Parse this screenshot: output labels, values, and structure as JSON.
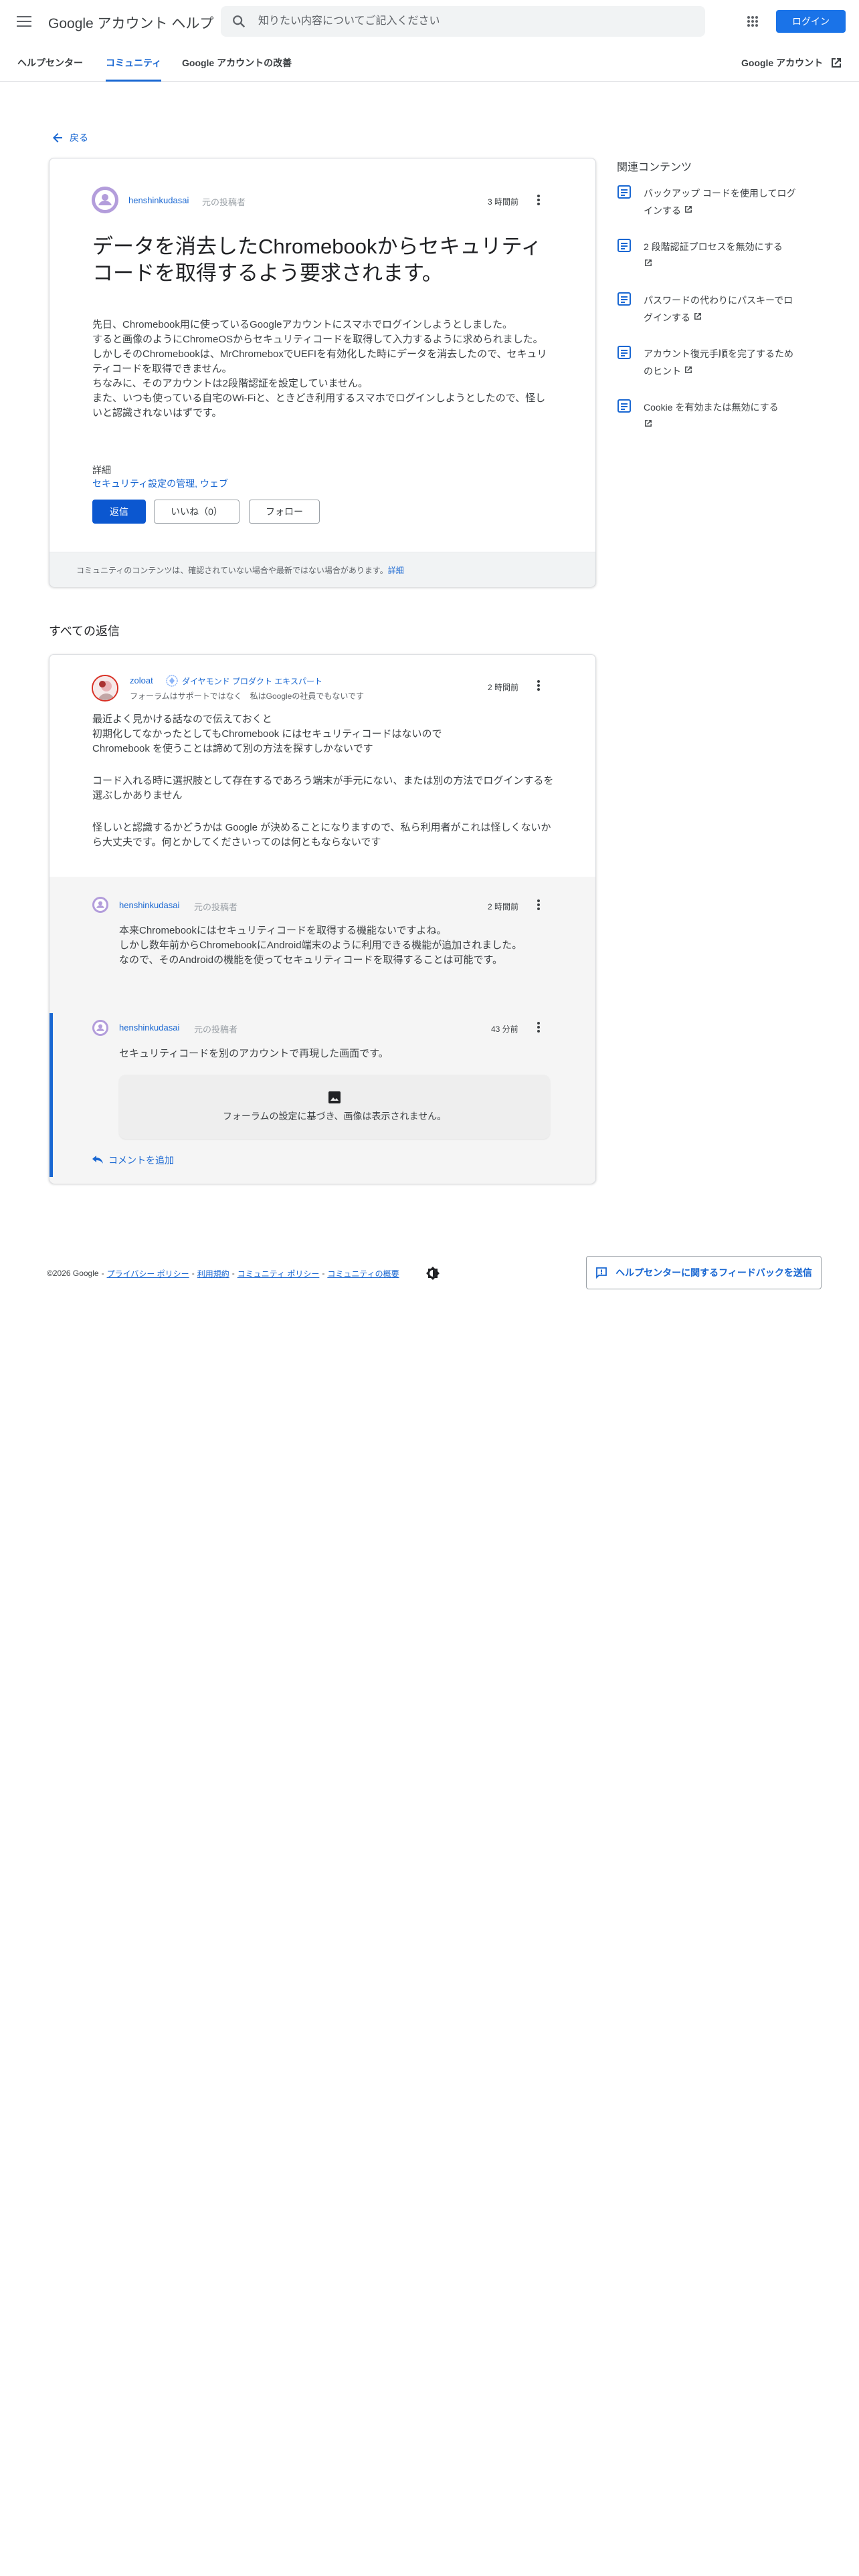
{
  "header": {
    "product_name": "Google アカウント ヘルプ",
    "search_placeholder": "知りたい内容についてご記入ください",
    "login_label": "ログイン"
  },
  "nav": {
    "tabs": [
      {
        "label": "ヘルプセンター",
        "active": false
      },
      {
        "label": "コミュニティ",
        "active": true
      },
      {
        "label": "Google アカウントの改善",
        "active": false
      }
    ],
    "account_link": "Google アカウント"
  },
  "back_label": "戻る",
  "question": {
    "author": "henshinkudasai",
    "author_role": "元の投稿者",
    "time": "3 時間前",
    "title": "データを消去したChromebookからセキュリティコードを取得するよう要求されます。",
    "body": [
      "先日、Chromebook用に使っているGoogleアカウントにスマホでログインしようとしました。",
      "すると画像のようにChromeOSからセキュリティコードを取得して入力するように求められました。",
      "しかしそのChromebookは、MrChromeboxでUEFIを有効化した時にデータを消去したので、セキュリティコードを取得できません。",
      "ちなみに、そのアカウントは2段階認証を設定していません。",
      "また、いつも使っている自宅のWi-Fiと、ときどき利用するスマホでログインしようとしたので、怪しいと認識されないはずです。"
    ],
    "details_label": "詳細",
    "details_value": "セキュリティ設定の管理, ウェブ",
    "reply_label": "返信",
    "like_label": "いいね（0）",
    "follow_label": "フォロー",
    "notice_text": "コミュニティのコンテンツは、確認されていない場合や最新ではない場合があります。",
    "notice_link": "詳細"
  },
  "related": {
    "title": "関連コンテンツ",
    "items": [
      "バックアップ コードを使用してログインする",
      "2 段階認証プロセスを無効にする",
      "パスワードの代わりにパスキーでログインする",
      "アカウント復元手順を完了するためのヒント",
      "Cookie を有効または無効にする"
    ]
  },
  "replies_heading": "すべての返信",
  "answer": {
    "author": "zoloat",
    "badge": "ダイヤモンド プロダクト エキスパート",
    "signature": "フォーラムはサポートではなく　私はGoogleの社員でもないです",
    "time": "2 時間前",
    "paragraphs": [
      "最近よく見かける話なので伝えておくと",
      "初期化してなかったとしてもChromebook にはセキュリティコードはないので",
      "Chromebook を使うことは諦めて別の方法を探すしかないです",
      "コード入れる時に選択肢として存在するであろう端末が手元にない、または別の方法でログインするを選ぶしかありません",
      "怪しいと認識するかどうかは Google が決めることになりますので、私ら利用者がこれは怪しくないから大丈夫です。何とかしてくださいってのは何ともならないです"
    ]
  },
  "comments": [
    {
      "author": "henshinkudasai",
      "role": "元の投稿者",
      "time": "2 時間前",
      "lines": [
        "本来Chromebookにはセキュリティコードを取得する機能ないですよね。",
        "しかし数年前からChromebookにAndroid端末のように利用できる機能が追加されました。",
        "なので、そのAndroidの機能を使ってセキュリティコードを取得することは可能です。"
      ]
    },
    {
      "author": "henshinkudasai",
      "role": "元の投稿者",
      "time": "43 分前",
      "lines": [
        "セキュリティコードを別のアカウントで再現した画面です。"
      ],
      "image_notice": "フォーラムの設定に基づき、画像は表示されません。"
    }
  ],
  "add_comment_label": "コメントを追加",
  "footer": {
    "copyright": "©2026 Google",
    "links": [
      "プライバシー ポリシー",
      "利用規約",
      "コミュニティ ポリシー",
      "コミュニティの概要"
    ],
    "feedback_label": "ヘルプセンターに関するフィードバックを送信"
  },
  "colors": {
    "accent": "#1967d2",
    "primary_button": "#0b57d0",
    "avatar": "#b39ddb",
    "comment_bg": "#f5f5f5"
  }
}
